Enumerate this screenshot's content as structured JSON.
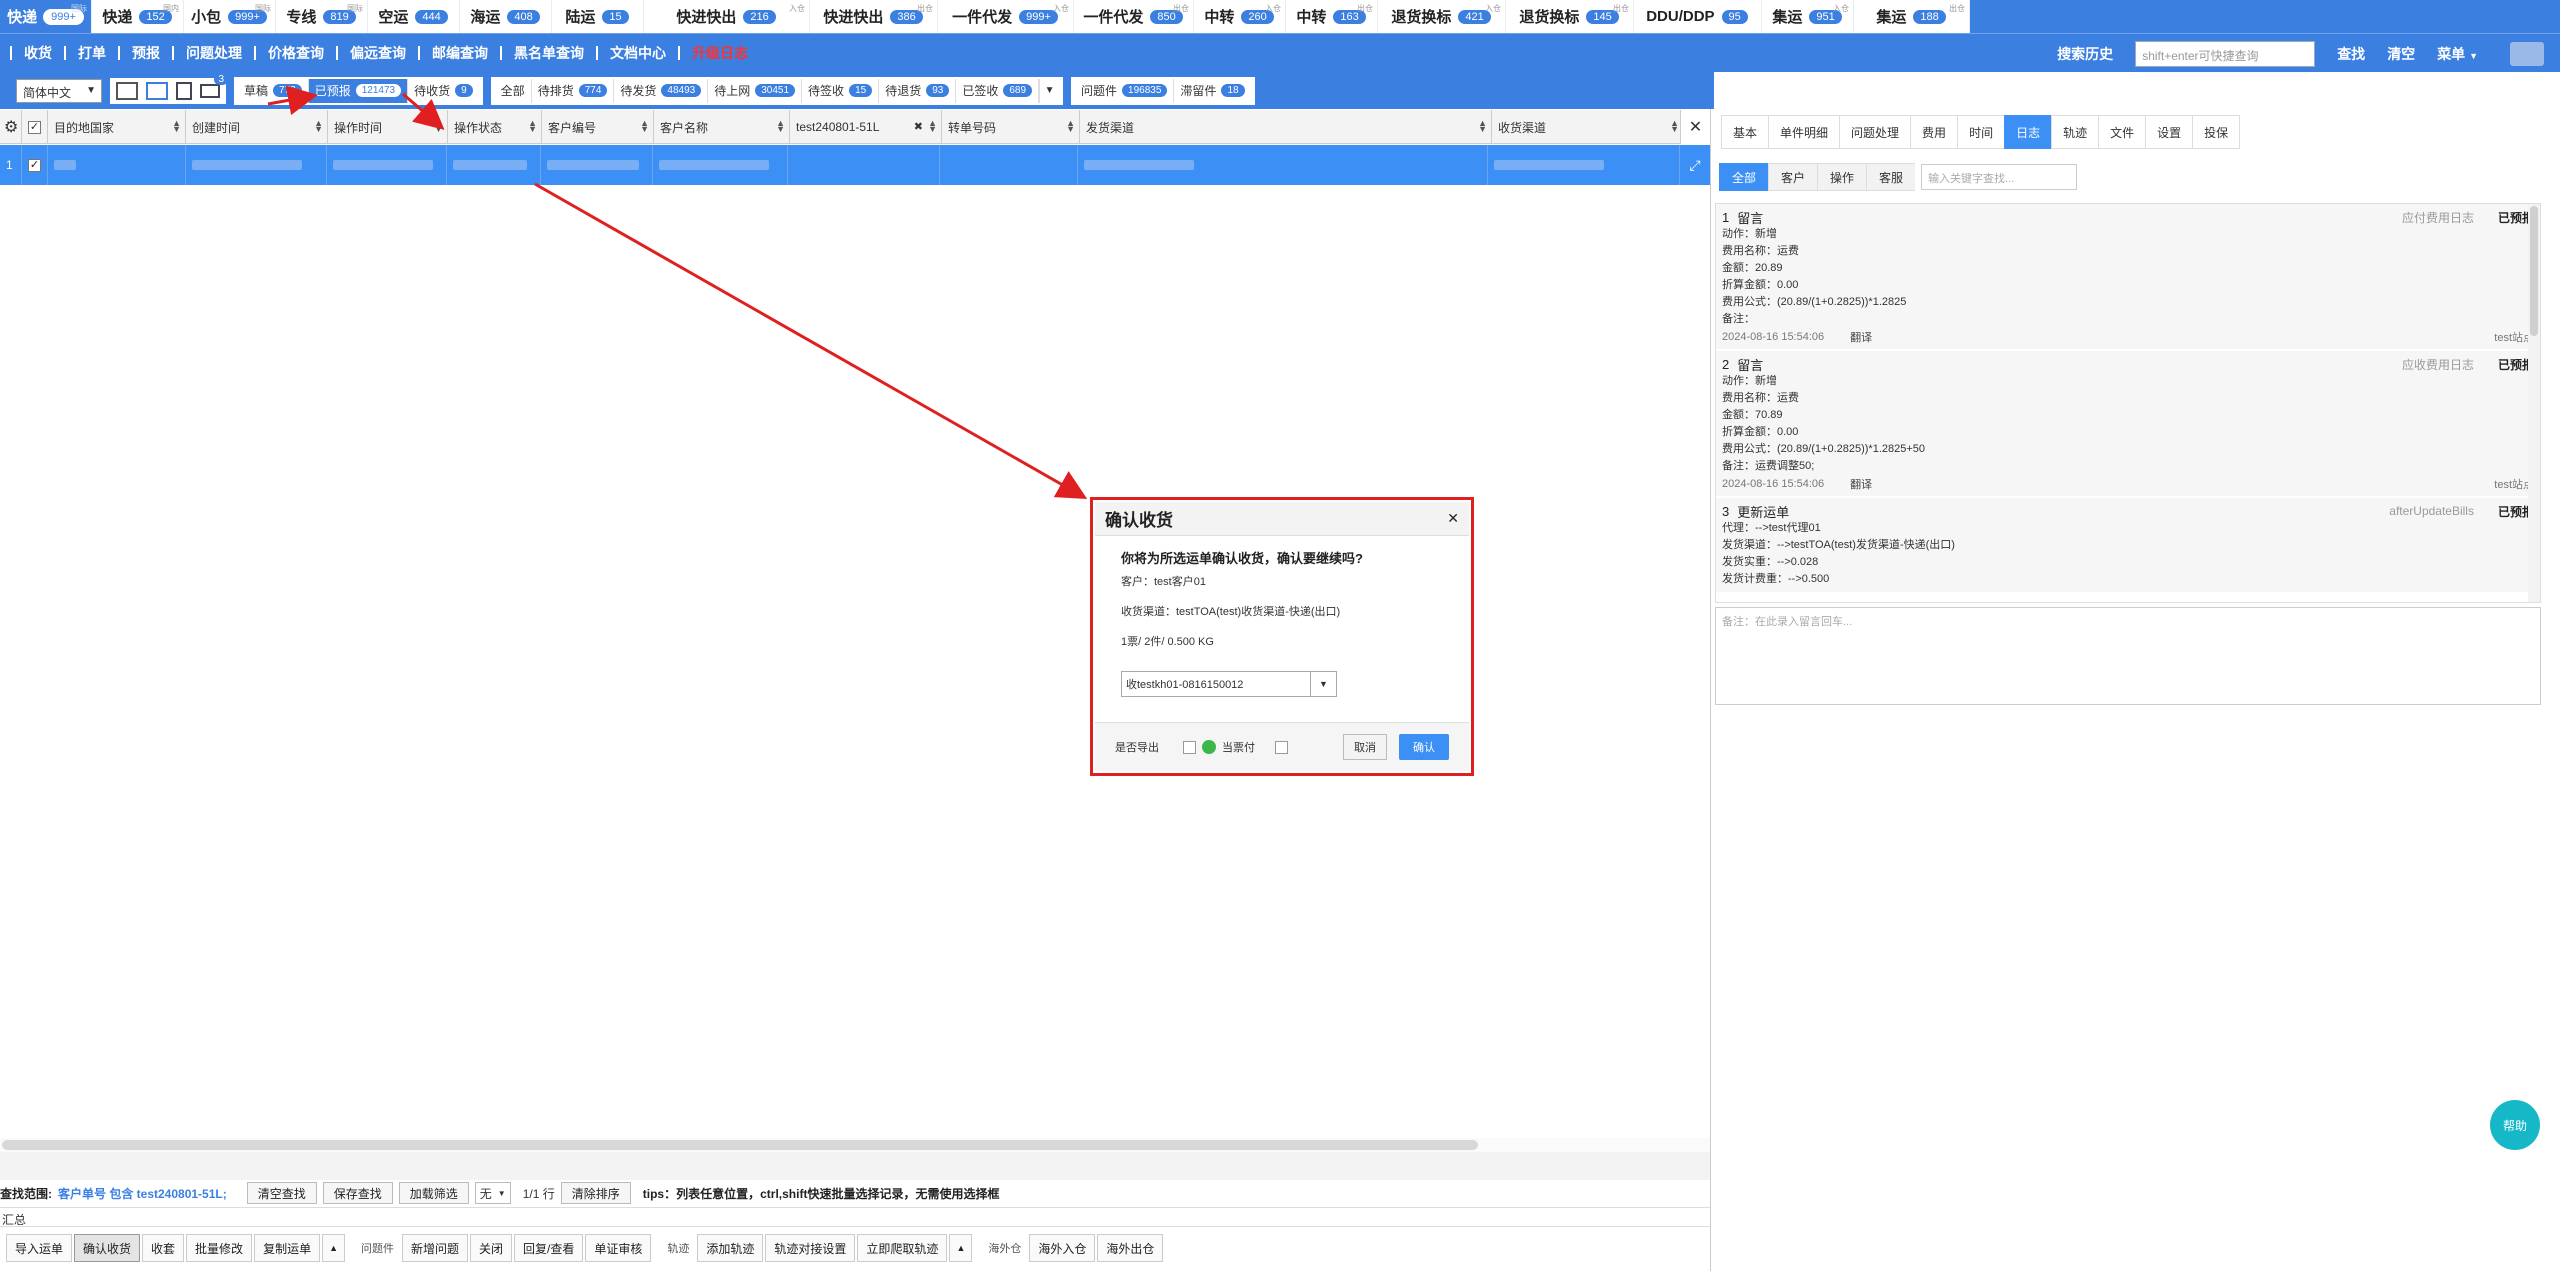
{
  "top_tabs": [
    {
      "label": "快递",
      "count": "999+",
      "sup": "国际",
      "w": 92,
      "style": "blue"
    },
    {
      "label": "快递",
      "count": "152",
      "sup": "国内",
      "w": 92,
      "style": "white"
    },
    {
      "label": "小包",
      "count": "999+",
      "sup": "国际",
      "w": 92,
      "style": "white"
    },
    {
      "label": "专线",
      "count": "819",
      "sup": "国际",
      "w": 92,
      "style": "white"
    },
    {
      "label": "空运",
      "count": "444",
      "sup": "",
      "w": 92,
      "style": "white"
    },
    {
      "label": "海运",
      "count": "408",
      "sup": "",
      "w": 92,
      "style": "white"
    },
    {
      "label": "陆运",
      "count": "15",
      "sup": "",
      "w": 92,
      "style": "white"
    },
    {
      "label": "快进快出",
      "count": "216",
      "sup": "入仓",
      "w": 166,
      "style": "white"
    },
    {
      "label": "快进快出",
      "count": "386",
      "sup": "出仓",
      "w": 128,
      "style": "white"
    },
    {
      "label": "一件代发",
      "count": "999+",
      "sup": "入仓",
      "w": 136,
      "style": "white"
    },
    {
      "label": "一件代发",
      "count": "850",
      "sup": "出仓",
      "w": 120,
      "style": "white"
    },
    {
      "label": "中转",
      "count": "260",
      "sup": "入仓",
      "w": 92,
      "style": "white"
    },
    {
      "label": "中转",
      "count": "163",
      "sup": "出仓",
      "w": 92,
      "style": "white"
    },
    {
      "label": "退货换标",
      "count": "421",
      "sup": "入仓",
      "w": 128,
      "style": "white"
    },
    {
      "label": "退货换标",
      "count": "145",
      "sup": "出仓",
      "w": 128,
      "style": "white"
    },
    {
      "label": "DDU/DDP",
      "count": "95",
      "sup": "",
      "w": 128,
      "style": "white"
    },
    {
      "label": "集运",
      "count": "951",
      "sup": "入仓",
      "w": 92,
      "style": "white"
    },
    {
      "label": "集运",
      "count": "188",
      "sup": "出仓",
      "w": 116,
      "style": "white"
    }
  ],
  "menu": {
    "items": [
      "收货",
      "打单",
      "预报",
      "问题处理",
      "价格查询",
      "偏远查询",
      "邮编查询",
      "黑名单查询",
      "文档中心"
    ],
    "upgrade_log": "升级日志",
    "search_history": "搜索历史",
    "quick_search_placeholder": "shift+enter可快捷查询",
    "search_btn": "查找",
    "clear_btn": "清空",
    "menu_btn": "菜单"
  },
  "filter": {
    "language": "简体中文",
    "mail_badge": "3",
    "group1": [
      {
        "label": "草稿",
        "count": "772",
        "active": false
      },
      {
        "label": "已预报",
        "count": "121473",
        "active": true
      },
      {
        "label": "待收货",
        "count": "9",
        "active": false
      }
    ],
    "group2": [
      {
        "label": "全部",
        "count": "",
        "active": false
      },
      {
        "label": "待排货",
        "count": "774",
        "active": false
      },
      {
        "label": "待发货",
        "count": "48493",
        "active": false
      },
      {
        "label": "待上网",
        "count": "30451",
        "active": false
      },
      {
        "label": "待签收",
        "count": "15",
        "active": false
      },
      {
        "label": "待退货",
        "count": "93",
        "active": false
      },
      {
        "label": "已签收",
        "count": "689",
        "active": false
      }
    ],
    "group3": [
      {
        "label": "问题件",
        "count": "196835",
        "active": false
      },
      {
        "label": "滞留件",
        "count": "18",
        "active": false
      }
    ]
  },
  "table": {
    "columns": [
      {
        "label": "目的地国家",
        "w": 138
      },
      {
        "label": "创建时间",
        "w": 142
      },
      {
        "label": "操作时间",
        "w": 120
      },
      {
        "label": "操作状态",
        "w": 94
      },
      {
        "label": "客户编号",
        "w": 112
      },
      {
        "label": "客户名称",
        "w": 136
      },
      {
        "label": "test240801-51L",
        "w": 152
      },
      {
        "label": "转单号码",
        "w": 138
      },
      {
        "label": "发货渠道",
        "w": 412
      },
      {
        "label": "收货渠道",
        "w": 192
      }
    ],
    "row_number": "1"
  },
  "search_bar": {
    "scope_label": "查找范围:",
    "scope_value": "客户单号 包含 test240801-51L;",
    "clear_search": "清空查找",
    "save_search": "保存查找",
    "add_filter": "加载筛选",
    "none_option": "无",
    "rows_info": "1/1 行",
    "clear_sort": "清除排序",
    "tips": "tips：列表任意位置，ctrl,shift快速批量选择记录，无需使用选择框"
  },
  "summary_label": "汇总",
  "bottom_buttons": {
    "group1": [
      "导入运单",
      "确认收货",
      "收套",
      "批量修改",
      "复制运单"
    ],
    "problem_label": "问题件",
    "group2": [
      "新增问题",
      "关闭",
      "回复/查看",
      "单证审核"
    ],
    "track_label": "轨迹",
    "group3": [
      "添加轨迹",
      "轨迹对接设置",
      "立即爬取轨迹"
    ],
    "overseas_label": "海外仓",
    "group4": [
      "海外入仓",
      "海外出仓"
    ]
  },
  "right_panel": {
    "tabs": [
      "基本",
      "单件明细",
      "问题处理",
      "费用",
      "时间",
      "日志",
      "轨迹",
      "文件",
      "设置",
      "投保"
    ],
    "active_tab": "日志",
    "subtabs": [
      "全部",
      "客户",
      "操作",
      "客服"
    ],
    "keyword_placeholder": "输入关键字查找...",
    "logs": [
      {
        "num": "1",
        "title": "留言",
        "type": "应付费用日志",
        "status": "已预报",
        "lines": [
          "动作：新增",
          "费用名称：运费",
          "金额：20.89",
          "折算金额：0.00",
          "费用公式：(20.89/(1+0.2825))*1.2825",
          "备注："
        ],
        "time": "2024-08-16 15:54:06",
        "translate": "翻译",
        "site": "test站点"
      },
      {
        "num": "2",
        "title": "留言",
        "type": "应收费用日志",
        "status": "已预报",
        "lines": [
          "动作：新增",
          "费用名称：运费",
          "金额：70.89",
          "折算金额：0.00",
          "费用公式：(20.89/(1+0.2825))*1.2825+50",
          "备注：运费调整50;"
        ],
        "time": "2024-08-16 15:54:06",
        "translate": "翻译",
        "site": "test站点"
      },
      {
        "num": "3",
        "title": "更新运单",
        "type": "afterUpdateBills",
        "status": "已预报",
        "lines": [
          "代理：-->test代理01",
          "发货渠道：-->testTOA(test)发货渠道-快递(出口)",
          "发货实重：-->0.028",
          "发货计费重：-->0.500"
        ],
        "time": "",
        "translate": "",
        "site": ""
      }
    ],
    "remark_placeholder": "备注：在此录入留言回车..."
  },
  "help_label": "帮助",
  "dialog": {
    "title": "确认收货",
    "question": "你将为所选运单确认收货，确认要继续吗?",
    "customer": "客户：test客户01",
    "channel": "收货渠道：testTOA(test)收货渠道-快递(出口)",
    "summary": "1票/ 2件/ 0.500 KG",
    "select_value": "收testkh01-0816150012",
    "export_label": "是否导出",
    "current_label": "当票付",
    "cancel": "取消",
    "confirm": "确认"
  }
}
